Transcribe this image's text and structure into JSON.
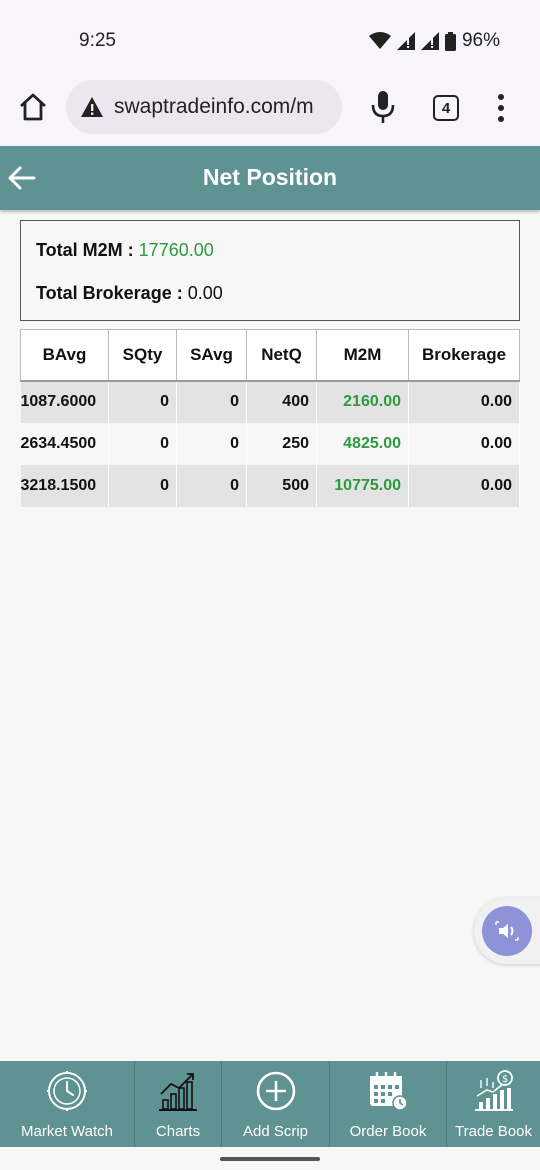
{
  "status_bar": {
    "time": "9:25",
    "battery": "96%"
  },
  "browser": {
    "url": "swaptradeinfo.com/m",
    "tab_count": "4"
  },
  "header": {
    "title": "Net Position"
  },
  "summary": {
    "m2m_label": "Total M2M :",
    "m2m_value": "17760.00",
    "brokerage_label": "Total Brokerage :",
    "brokerage_value": "0.00"
  },
  "table": {
    "columns": [
      "BAvg",
      "SQty",
      "SAvg",
      "NetQ",
      "M2M",
      "Brokerage"
    ],
    "rows": [
      [
        "1087.6000",
        "0",
        "0",
        "400",
        "2160.00",
        "0.00"
      ],
      [
        "2634.4500",
        "0",
        "0",
        "250",
        "4825.00",
        "0.00"
      ],
      [
        "3218.1500",
        "0",
        "0",
        "500",
        "10775.00",
        "0.00"
      ]
    ]
  },
  "bottom_nav": {
    "items": [
      {
        "label": "Market Watch",
        "icon": "clock-icon"
      },
      {
        "label": "Charts",
        "icon": "chart-icon"
      },
      {
        "label": "Add Scrip",
        "icon": "plus-circle-icon"
      },
      {
        "label": "Order Book",
        "icon": "calendar-icon"
      },
      {
        "label": "Trade Book",
        "icon": "trade-chart-icon"
      }
    ]
  },
  "colors": {
    "primary": "#5f9293",
    "positive": "#2e9a3e",
    "float_button": "#8e92d8"
  }
}
